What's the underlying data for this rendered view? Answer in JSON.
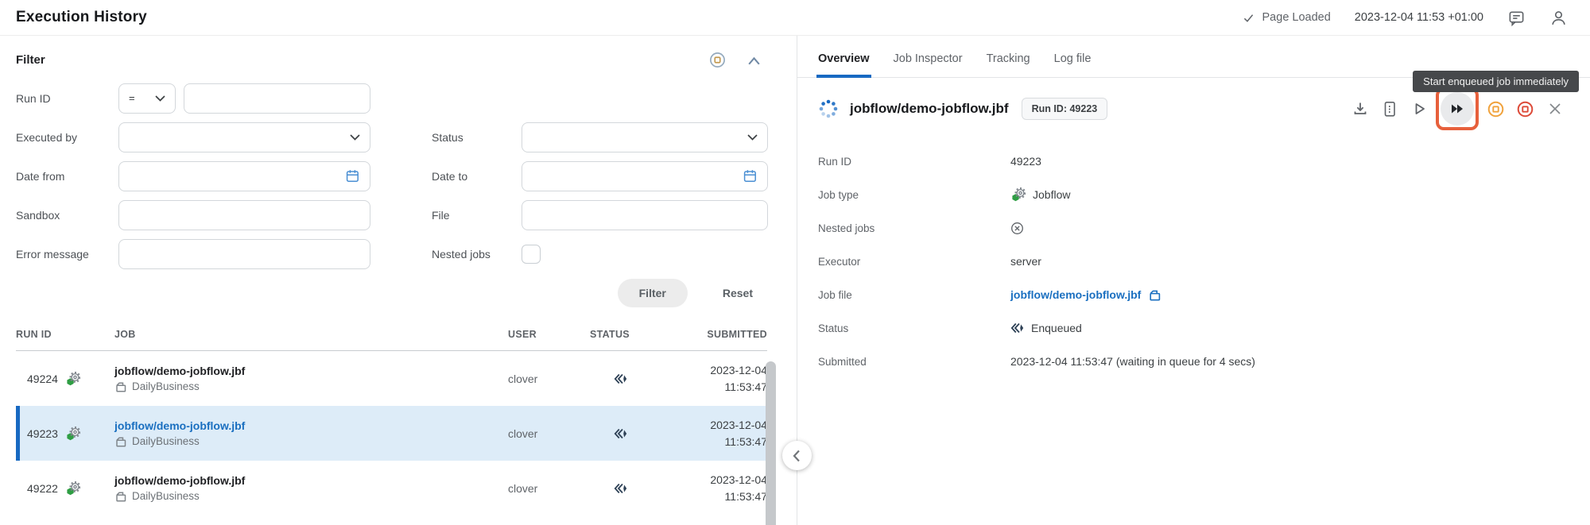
{
  "header": {
    "title": "Execution History",
    "page_status": "Page Loaded",
    "timestamp": "2023-12-04 11:53 +01:00"
  },
  "filter": {
    "title": "Filter",
    "run_id_label": "Run ID",
    "run_id_operator": "=",
    "executed_by_label": "Executed by",
    "status_label": "Status",
    "date_from_label": "Date from",
    "date_to_label": "Date to",
    "sandbox_label": "Sandbox",
    "file_label": "File",
    "error_message_label": "Error message",
    "nested_jobs_label": "Nested jobs",
    "filter_button": "Filter",
    "reset_button": "Reset"
  },
  "table": {
    "columns": [
      "RUN ID",
      "JOB",
      "USER",
      "STATUS",
      "SUBMITTED"
    ],
    "rows": [
      {
        "run_id": "49224",
        "job": "jobflow/demo-jobflow.jbf",
        "sandbox": "DailyBusiness",
        "user": "clover",
        "status": "Enqueued",
        "submitted_date": "2023-12-04",
        "submitted_time": "11:53:47"
      },
      {
        "run_id": "49223",
        "job": "jobflow/demo-jobflow.jbf",
        "sandbox": "DailyBusiness",
        "user": "clover",
        "status": "Enqueued",
        "submitted_date": "2023-12-04",
        "submitted_time": "11:53:47",
        "selected": true
      },
      {
        "run_id": "49222",
        "job": "jobflow/demo-jobflow.jbf",
        "sandbox": "DailyBusiness",
        "user": "clover",
        "status": "Enqueued",
        "submitted_date": "2023-12-04",
        "submitted_time": "11:53:47"
      }
    ]
  },
  "detail": {
    "tabs": [
      {
        "label": "Overview",
        "active": true
      },
      {
        "label": "Job Inspector"
      },
      {
        "label": "Tracking"
      },
      {
        "label": "Log file"
      }
    ],
    "job_title": "jobflow/demo-jobflow.jbf",
    "run_id_badge": "Run ID: 49223",
    "tooltip": "Start enqueued job immediately",
    "fields": {
      "run_id": {
        "label": "Run ID",
        "value": "49223"
      },
      "job_type": {
        "label": "Job type",
        "value": "Jobflow"
      },
      "nested_jobs": {
        "label": "Nested jobs",
        "value": ""
      },
      "executor": {
        "label": "Executor",
        "value": "server"
      },
      "job_file": {
        "label": "Job file",
        "value": "jobflow/demo-jobflow.jbf"
      },
      "status": {
        "label": "Status",
        "value": "Enqueued"
      },
      "submitted": {
        "label": "Submitted",
        "value": "2023-12-04 11:53:47 (waiting in queue for 4 secs)"
      }
    }
  },
  "colors": {
    "accent_blue": "#1a6fc0",
    "tab_underline_blue": "#1769c2",
    "selected_row_bg": "#ddecf8",
    "annotation_orange": "#e7603c",
    "tooltip_bg": "#46484b",
    "status_icon_slate": "#2e4156",
    "jobflow_green": "#2f9e44",
    "suspend_orange": "#f0a23c",
    "stop_red": "#dd4a38"
  }
}
